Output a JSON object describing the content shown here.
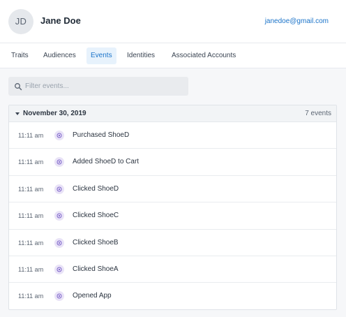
{
  "profile": {
    "initials": "JD",
    "name": "Jane Doe",
    "email": "janedoe@gmail.com"
  },
  "tabs": [
    {
      "label": "Traits"
    },
    {
      "label": "Audiences"
    },
    {
      "label": "Events",
      "active": true
    },
    {
      "label": "Identities"
    },
    {
      "label": "Associated Accounts"
    }
  ],
  "filter": {
    "placeholder": "Filter events...",
    "icon": "search-icon"
  },
  "group": {
    "date": "November 30, 2019",
    "count": "7 events",
    "events": [
      {
        "time": "11:11 am",
        "name": "Purchased ShoeD",
        "icon": "track-event-icon"
      },
      {
        "time": "11:11 am",
        "name": "Added ShoeD to Cart",
        "icon": "track-event-icon"
      },
      {
        "time": "11:11 am",
        "name": "Clicked ShoeD",
        "icon": "track-event-icon"
      },
      {
        "time": "11:11 am",
        "name": "Clicked ShoeC",
        "icon": "track-event-icon"
      },
      {
        "time": "11:11 am",
        "name": "Clicked ShoeB",
        "icon": "track-event-icon"
      },
      {
        "time": "11:11 am",
        "name": "Clicked ShoeA",
        "icon": "track-event-icon"
      },
      {
        "time": "11:11 am",
        "name": "Opened App",
        "icon": "track-event-icon"
      }
    ]
  },
  "colors": {
    "accent": "#1a73c9",
    "event_icon_bg": "#e9e3f7",
    "event_icon_fg": "#7b61c9"
  }
}
